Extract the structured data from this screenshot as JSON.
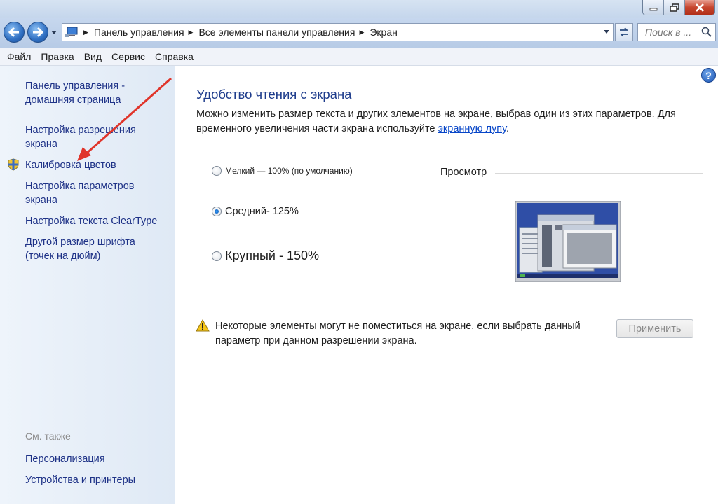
{
  "window": {
    "controls": [
      "minimize-icon",
      "maximize-icon",
      "close-icon"
    ]
  },
  "address": {
    "crumbs": [
      "Панель управления",
      "Все элементы панели управления",
      "Экран"
    ],
    "search_placeholder": "Поиск в ..."
  },
  "menu": [
    "Файл",
    "Правка",
    "Вид",
    "Сервис",
    "Справка"
  ],
  "sidebar": {
    "home": [
      "Панель управления -",
      "домашняя страница"
    ],
    "resolution": [
      "Настройка разрешения",
      "экрана"
    ],
    "calibration": "Калибровка цветов",
    "display_settings": [
      "Настройка параметров",
      "экрана"
    ],
    "cleartype": "Настройка текста ClearType",
    "dpi": [
      "Другой размер шрифта",
      "(точек на дюйм)"
    ],
    "see_also": "См. также",
    "personalization": "Персонализация",
    "devices": "Устройства и принтеры"
  },
  "main": {
    "heading": "Удобство чтения с экрана",
    "description_part1": "Можно изменить размер текста и других элементов на экране, выбрав один из этих параметров. Для временного увеличения части экрана используйте ",
    "magnifier_link": "экранную лупу",
    "description_part2": ".",
    "options": [
      {
        "label": "Мелкий — 100% (по умолчанию)",
        "selected": false
      },
      {
        "label": "Средний- 125%",
        "selected": true
      },
      {
        "label": "Крупный - 150%",
        "selected": false
      }
    ],
    "preview_label": "Просмотр",
    "warning_line1": "Некоторые элементы могут не поместиться на экране, если выбрать данный",
    "warning_line2": "параметр при данном разрешении экрана.",
    "apply_button": "Применить"
  },
  "colors": {
    "link": "#1e3287",
    "heading": "#1e3c8c",
    "arrow": "#e0352b"
  }
}
